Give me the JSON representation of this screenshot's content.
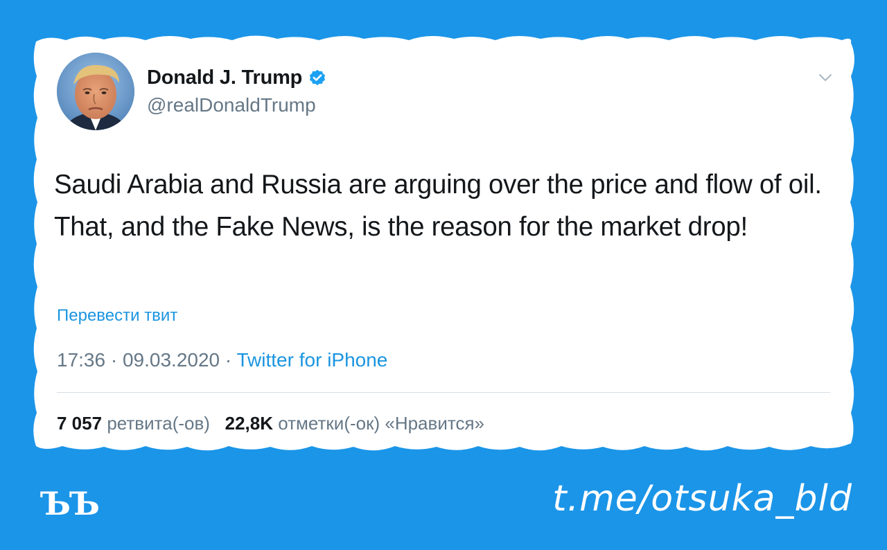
{
  "colors": {
    "background": "#1b95e8",
    "card": "#ffffff",
    "link": "#1b95e0",
    "secondary_text": "#657786",
    "primary_text": "#14171a"
  },
  "tweet": {
    "author_name": "Donald J. Trump",
    "author_handle": "@realDonaldTrump",
    "verified_icon": "verified-badge-icon",
    "menu_icon": "chevron-down-icon",
    "text": "Saudi Arabia and Russia are arguing over the price and flow of oil. That, and the Fake News, is the reason for the market drop!",
    "translate_label": "Перевести твит",
    "time": "17:36",
    "date": "09.03.2020",
    "separator": "·",
    "source": "Twitter for iPhone",
    "retweets_count": "7 057",
    "retweets_label": "ретвита(-ов)",
    "likes_count": "22,8K",
    "likes_label": "отметки(-ок) «Нравится»"
  },
  "footer": {
    "logo_text": "ЪЪ",
    "channel_link": "t.me/otsuka_bld"
  }
}
